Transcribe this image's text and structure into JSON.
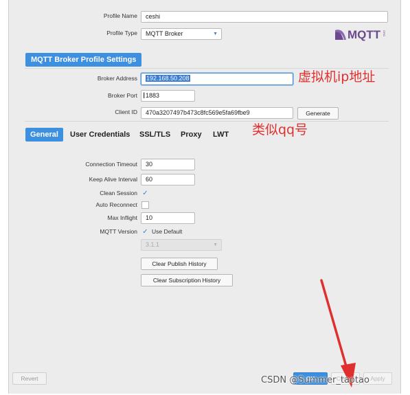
{
  "profile": {
    "name_label": "Profile Name",
    "name_value": "ceshi",
    "type_label": "Profile Type",
    "type_value": "MQTT Broker"
  },
  "logo": {
    "text": "MQTT",
    "sub": "ORG"
  },
  "section": {
    "title": "MQTT Broker Profile Settings"
  },
  "broker": {
    "address_label": "Broker Address",
    "address_value": "192.168.50.208",
    "port_label": "Broker Port",
    "port_value": "1883",
    "client_id_label": "Client ID",
    "client_id_value": "470a3207497b473c8fc569e5fa69fbe9",
    "generate_label": "Generate"
  },
  "tabs": [
    {
      "label": "General"
    },
    {
      "label": "User Credentials"
    },
    {
      "label": "SSL/TLS"
    },
    {
      "label": "Proxy"
    },
    {
      "label": "LWT"
    }
  ],
  "general": {
    "connection_timeout_label": "Connection Timeout",
    "connection_timeout_value": "30",
    "keep_alive_label": "Keep Alive Interval",
    "keep_alive_value": "60",
    "clean_session_label": "Clean Session",
    "auto_reconnect_label": "Auto Reconnect",
    "max_inflight_label": "Max Inflight",
    "max_inflight_value": "10",
    "mqtt_version_label": "MQTT Version",
    "use_default_label": "Use Default",
    "version_value": "3.1.1",
    "clear_publish_label": "Clear Publish History",
    "clear_subscription_label": "Clear Subscription History"
  },
  "footer": {
    "revert_label": "Revert",
    "ok_label": "OK",
    "cancel_label": "Cancel",
    "apply_label": "Apply"
  },
  "annotations": {
    "ip_note": "虚拟机ip地址",
    "id_note": "类似qq号",
    "watermark": "CSDN @Summer_taotao"
  },
  "colors": {
    "accent": "#3d8fe0",
    "annotation": "#e0302e",
    "logo_purple": "#6b4a8e"
  }
}
